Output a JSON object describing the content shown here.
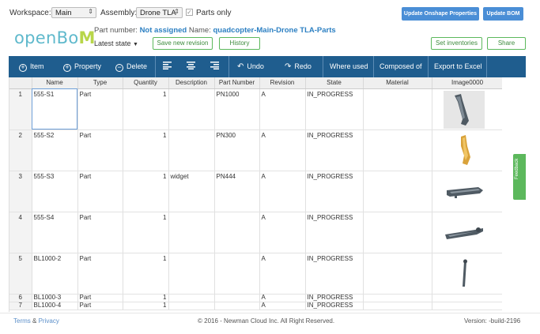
{
  "topbar": {
    "workspace_label": "Workspace:",
    "workspace_value": "Main",
    "assembly_label": "Assembly:",
    "assembly_value": "Drone TLA",
    "parts_only_label": "Parts only",
    "update_onshape_label": "Update Onshape Properties",
    "update_bom_label": "Update BOM"
  },
  "header": {
    "logo": {
      "part1": "open",
      "part2": "Bo",
      "part3": "M"
    },
    "part_number_label": "Part number:",
    "part_number_value": "Not assigned",
    "name_label": "Name:",
    "name_value": "quadcopter-Main-Drone TLA-Parts",
    "latest_state": "Latest state",
    "save_revision_label": "Save new revision",
    "history_label": "History",
    "set_inventories_label": "Set inventories",
    "share_label": "Share"
  },
  "toolbar": {
    "item": "Item",
    "property": "Property",
    "delete": "Delete",
    "undo": "Undo",
    "redo": "Redo",
    "where_used": "Where used",
    "composed_of": "Composed of",
    "export": "Export to Excel"
  },
  "table": {
    "columns": [
      "",
      "Name",
      "Type",
      "Quantity",
      "Description",
      "Part Number",
      "Revision",
      "State",
      "Material",
      "Image0000"
    ],
    "rows": [
      {
        "num": "1",
        "name": "555-S1",
        "type": "Part",
        "qty": "1",
        "desc": "",
        "pn": "PN1000",
        "rev": "A",
        "state": "IN_PROGRESS",
        "material": ""
      },
      {
        "num": "2",
        "name": "555-S2",
        "type": "Part",
        "qty": "1",
        "desc": "",
        "pn": "PN300",
        "rev": "A",
        "state": "IN_PROGRESS",
        "material": ""
      },
      {
        "num": "3",
        "name": "555-S3",
        "type": "Part",
        "qty": "1",
        "desc": "widget",
        "pn": "PN444",
        "rev": "A",
        "state": "IN_PROGRESS",
        "material": ""
      },
      {
        "num": "4",
        "name": "555-S4",
        "type": "Part",
        "qty": "1",
        "desc": "",
        "pn": "",
        "rev": "A",
        "state": "IN_PROGRESS",
        "material": ""
      },
      {
        "num": "5",
        "name": "BL1000-2",
        "type": "Part",
        "qty": "1",
        "desc": "",
        "pn": "",
        "rev": "A",
        "state": "IN_PROGRESS",
        "material": ""
      },
      {
        "num": "6",
        "name": "BL1000-3",
        "type": "Part",
        "qty": "1",
        "desc": "",
        "pn": "",
        "rev": "A",
        "state": "IN_PROGRESS",
        "material": ""
      },
      {
        "num": "7",
        "name": "BL1000-4",
        "type": "Part",
        "qty": "1",
        "desc": "",
        "pn": "",
        "rev": "A",
        "state": "IN_PROGRESS",
        "material": ""
      }
    ]
  },
  "feedback_label": "Feedback",
  "footer": {
    "terms": "Terms",
    "amp": "&",
    "privacy": "Privacy",
    "copyright": "© 2016 - Newman Cloud Inc. All Right Reserved.",
    "version": "Version: -build-2196"
  },
  "colors": {
    "toolbar_bg": "#1f5d8e",
    "accent_blue": "#4a8ed6",
    "accent_green": "#5cb85c",
    "logo_teal": "#5fb9cc"
  }
}
